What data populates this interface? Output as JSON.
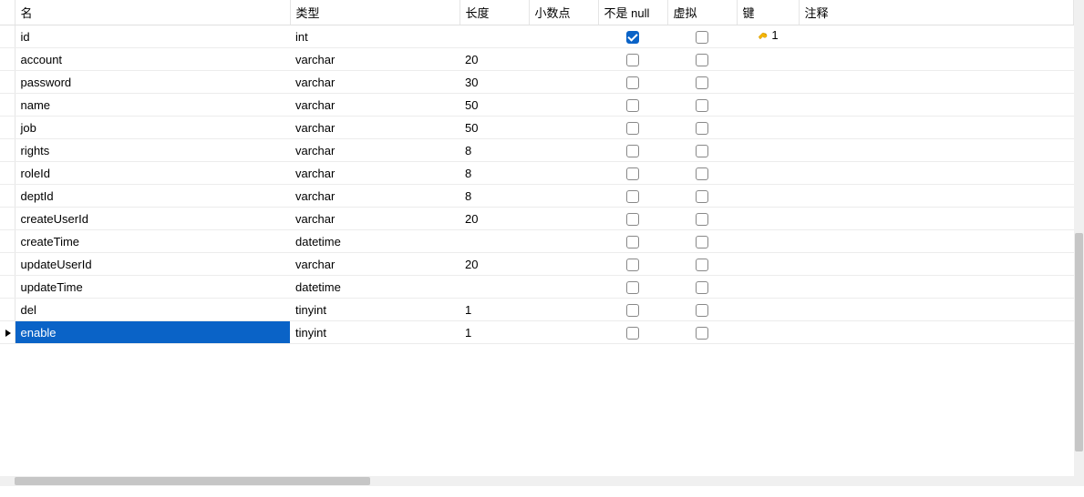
{
  "headers": {
    "name": "名",
    "type": "类型",
    "length": "长度",
    "decimal": "小数点",
    "notnull": "不是 null",
    "virtual": "虚拟",
    "key": "键",
    "comment": "注释"
  },
  "rows": [
    {
      "name": "id",
      "type": "int",
      "length": "",
      "decimal": "",
      "notnull": true,
      "virtual": false,
      "key": "1",
      "comment": "",
      "selected": false
    },
    {
      "name": "account",
      "type": "varchar",
      "length": "20",
      "decimal": "",
      "notnull": false,
      "virtual": false,
      "key": "",
      "comment": "",
      "selected": false
    },
    {
      "name": "password",
      "type": "varchar",
      "length": "30",
      "decimal": "",
      "notnull": false,
      "virtual": false,
      "key": "",
      "comment": "",
      "selected": false
    },
    {
      "name": "name",
      "type": "varchar",
      "length": "50",
      "decimal": "",
      "notnull": false,
      "virtual": false,
      "key": "",
      "comment": "",
      "selected": false
    },
    {
      "name": "job",
      "type": "varchar",
      "length": "50",
      "decimal": "",
      "notnull": false,
      "virtual": false,
      "key": "",
      "comment": "",
      "selected": false
    },
    {
      "name": "rights",
      "type": "varchar",
      "length": "8",
      "decimal": "",
      "notnull": false,
      "virtual": false,
      "key": "",
      "comment": "",
      "selected": false
    },
    {
      "name": "roleId",
      "type": "varchar",
      "length": "8",
      "decimal": "",
      "notnull": false,
      "virtual": false,
      "key": "",
      "comment": "",
      "selected": false
    },
    {
      "name": "deptId",
      "type": "varchar",
      "length": "8",
      "decimal": "",
      "notnull": false,
      "virtual": false,
      "key": "",
      "comment": "",
      "selected": false
    },
    {
      "name": "createUserId",
      "type": "varchar",
      "length": "20",
      "decimal": "",
      "notnull": false,
      "virtual": false,
      "key": "",
      "comment": "",
      "selected": false
    },
    {
      "name": "createTime",
      "type": "datetime",
      "length": "",
      "decimal": "",
      "notnull": false,
      "virtual": false,
      "key": "",
      "comment": "",
      "selected": false
    },
    {
      "name": "updateUserId",
      "type": "varchar",
      "length": "20",
      "decimal": "",
      "notnull": false,
      "virtual": false,
      "key": "",
      "comment": "",
      "selected": false
    },
    {
      "name": "updateTime",
      "type": "datetime",
      "length": "",
      "decimal": "",
      "notnull": false,
      "virtual": false,
      "key": "",
      "comment": "",
      "selected": false
    },
    {
      "name": "del",
      "type": "tinyint",
      "length": "1",
      "decimal": "",
      "notnull": false,
      "virtual": false,
      "key": "",
      "comment": "",
      "selected": false
    },
    {
      "name": "enable",
      "type": "tinyint",
      "length": "1",
      "decimal": "",
      "notnull": false,
      "virtual": false,
      "key": "",
      "comment": "",
      "selected": true
    }
  ]
}
